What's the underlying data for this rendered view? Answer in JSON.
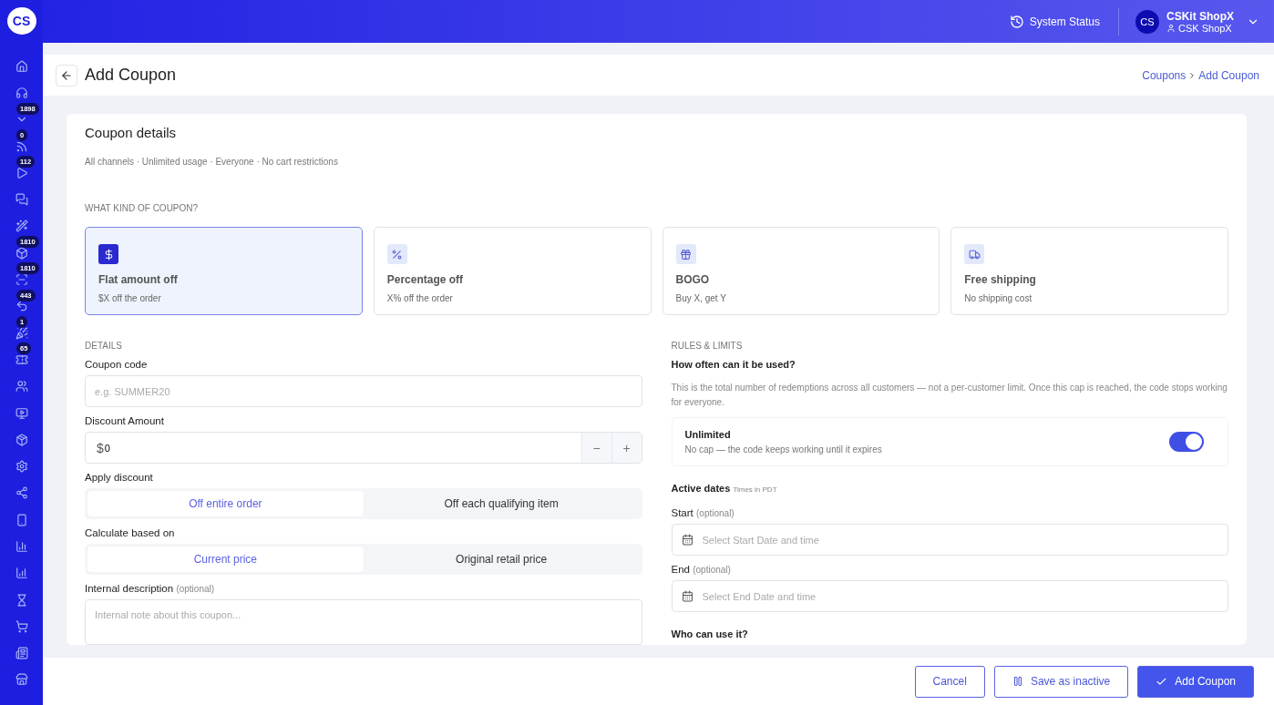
{
  "logo": "CS",
  "sidebar": {
    "items": [
      {
        "kind": "home"
      },
      {
        "kind": "headset"
      },
      {
        "kind": "chevron",
        "badge": "1898"
      },
      {
        "kind": "rss",
        "badge": "0"
      },
      {
        "kind": "play",
        "badge": "112"
      },
      {
        "kind": "chat"
      },
      {
        "kind": "wand"
      },
      {
        "kind": "box",
        "badge": "1810"
      },
      {
        "kind": "scan",
        "badge": "1810"
      },
      {
        "kind": "undo",
        "badge": "443"
      },
      {
        "kind": "party",
        "badge": "1"
      },
      {
        "kind": "ticket",
        "badge": "65"
      },
      {
        "kind": "users"
      },
      {
        "kind": "monitor"
      },
      {
        "kind": "package"
      },
      {
        "kind": "settings"
      },
      {
        "kind": "share"
      },
      {
        "kind": "phone"
      },
      {
        "kind": "chart"
      },
      {
        "kind": "chart2"
      },
      {
        "kind": "hourglass"
      },
      {
        "kind": "cart"
      },
      {
        "kind": "news"
      },
      {
        "kind": "store"
      }
    ]
  },
  "header": {
    "status": "System Status",
    "avatar": "CS",
    "account": "CSKit ShopX",
    "user": "CSK ShopX"
  },
  "page": {
    "title": "Add Coupon",
    "breadcrumb": [
      "Coupons",
      "Add Coupon"
    ]
  },
  "card": {
    "title": "Coupon details",
    "summary": "All channels · Unlimited usage · Everyone · No cart restrictions",
    "type_label": "WHAT KIND OF COUPON?",
    "types": [
      {
        "kind": "dollar",
        "label": "Flat amount off",
        "description": "$X off the order",
        "selected": true
      },
      {
        "kind": "percent",
        "label": "Percentage off",
        "description": "X% off the order",
        "selected": false
      },
      {
        "kind": "gift",
        "label": "BOGO",
        "description": "Buy X, get Y",
        "selected": false
      },
      {
        "kind": "truck",
        "label": "Free shipping",
        "description": "No shipping cost",
        "selected": false
      }
    ]
  },
  "details": {
    "heading": "DETAILS",
    "code_label": "Coupon code",
    "code_placeholder": "e.g. SUMMER20",
    "amount_label": "Discount Amount",
    "currency": "$",
    "amount": "0",
    "minus": "−",
    "plus": "+",
    "apply_label": "Apply discount",
    "apply_options": [
      {
        "label": "Off entire order",
        "selected": true
      },
      {
        "label": "Off each qualifying item",
        "selected": false
      }
    ],
    "calc_label": "Calculate based on",
    "calc_options": [
      {
        "label": "Current price",
        "selected": true
      },
      {
        "label": "Original retail price",
        "selected": false
      }
    ],
    "desc_label": "Internal description",
    "desc_hint": "(optional)",
    "desc_placeholder": "Internal note about this coupon..."
  },
  "rules": {
    "heading": "RULES & LIMITS",
    "usage_title": "How often can it be used?",
    "usage_text": "This is the total number of redemptions across all customers — not a per-customer limit. Once this cap is reached, the code stops working for everyone.",
    "unlimited": {
      "title": "Unlimited",
      "text": "No cap — the code keeps working until it expires",
      "on": true
    },
    "dates_title": "Active dates",
    "dates_hint": "Times in PDT",
    "start_label": "Start",
    "start_hint": "(optional)",
    "start_placeholder": "Select Start Date and time",
    "end_label": "End",
    "end_hint": "(optional)",
    "end_placeholder": "Select End Date and time",
    "who_title": "Who can use it?"
  },
  "footer": {
    "cancel": "Cancel",
    "inactive": "Save as inactive",
    "submit": "Add Coupon"
  }
}
